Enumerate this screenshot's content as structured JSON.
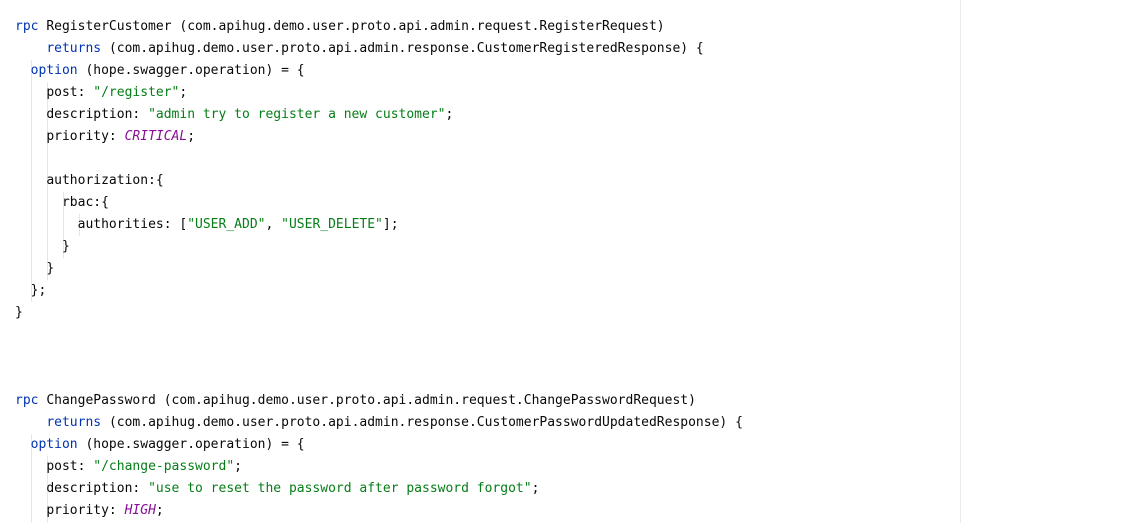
{
  "code": {
    "block1": {
      "rpc_keyword": "rpc",
      "rpc_name": "RegisterCustomer",
      "request_type": "(com.apihug.demo.user.proto.api.admin.request.RegisterRequest)",
      "returns_keyword": "returns",
      "response_type": "(com.apihug.demo.user.proto.api.admin.response.CustomerRegisteredResponse) {",
      "option_keyword": "option",
      "option_value": "(hope.swagger.operation) = {",
      "post_key": "post: ",
      "post_value": "\"/register\"",
      "description_key": "description: ",
      "description_value": "\"admin try to register a new customer\"",
      "priority_key": "priority: ",
      "priority_value": "CRITICAL",
      "semicolon": ";",
      "authorization_open": "authorization:{",
      "rbac_open": "rbac:{",
      "authorities_key": "authorities: [",
      "authority_1": "\"USER_ADD\"",
      "authority_separator": ", ",
      "authority_2": "\"USER_DELETE\"",
      "authorities_close": "];",
      "close_rbac": "}",
      "close_authorization": "}",
      "close_option": "};",
      "close_rpc": "}"
    },
    "block2": {
      "rpc_keyword": "rpc",
      "rpc_name": "ChangePassword",
      "request_type": "(com.apihug.demo.user.proto.api.admin.request.ChangePasswordRequest)",
      "returns_keyword": "returns",
      "response_type": "(com.apihug.demo.user.proto.api.admin.response.CustomerPasswordUpdatedResponse) {",
      "option_keyword": "option",
      "option_value": "(hope.swagger.operation) = {",
      "post_key": "post: ",
      "post_value": "\"/change-password\"",
      "description_key": "description: ",
      "description_value": "\"use to reset the password after password forgot\"",
      "priority_key": "priority: ",
      "priority_value": "HIGH",
      "semicolon": ";"
    }
  },
  "colors": {
    "keyword": "#0033b3",
    "string": "#067d17",
    "enum": "#871094",
    "text": "#080808",
    "background": "#ffffff"
  }
}
